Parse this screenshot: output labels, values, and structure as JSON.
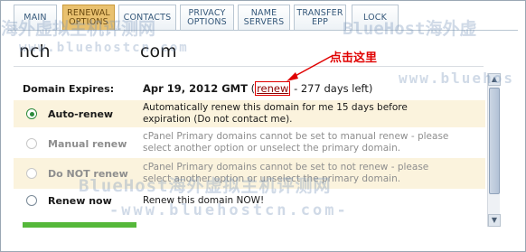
{
  "tabs": [
    {
      "label_lines": [
        "MAIN"
      ],
      "active": false
    },
    {
      "label_lines": [
        "RENEWAL",
        "OPTIONS"
      ],
      "active": true
    },
    {
      "label_lines": [
        "CONTACTS"
      ],
      "active": false
    },
    {
      "label_lines": [
        "PRIVACY",
        "OPTIONS"
      ],
      "active": false
    },
    {
      "label_lines": [
        "NAME",
        "SERVERS"
      ],
      "active": false
    },
    {
      "label_lines": [
        "TRANSFER",
        "EPP"
      ],
      "active": false
    },
    {
      "label_lines": [
        "LOCK"
      ],
      "active": false
    }
  ],
  "domain": {
    "name": "nch",
    "tld": "com"
  },
  "annotation": {
    "text": "点击这里"
  },
  "expires": {
    "label": "Domain Expires:",
    "date": "Apr 19, 2012 GMT",
    "link": "renew",
    "suffix": "- 277 days left)"
  },
  "options": [
    {
      "label": "Auto-renew",
      "line1": "Automatically renew this domain for me 15 days before",
      "line2": "expiration (Do not contact me).",
      "state": "selected"
    },
    {
      "label": "Manual renew",
      "line1": "cPanel Primary domains cannot be set to manual renew - please",
      "line2": "select another option or unselect the primary domain.",
      "state": "disabled"
    },
    {
      "label": "Do NOT renew",
      "line1": "cPanel Primary domains cannot be set to not renew - please",
      "line2": "select another option or unselect the primary domain.",
      "state": "disabled"
    },
    {
      "label": "Renew now",
      "line1": "Renew this domain NOW!",
      "line2": "",
      "state": "normal"
    }
  ],
  "watermark": {
    "line_a": "海外虚拟主机评测网",
    "line_b": "BlueHost海外虚",
    "line_c": "www.bluehostcn.com",
    "line_d": "www.bluehos",
    "line_e": "BlueHost海外虚拟主机评测网",
    "line_f": "-www.bluehostcn.com-"
  }
}
